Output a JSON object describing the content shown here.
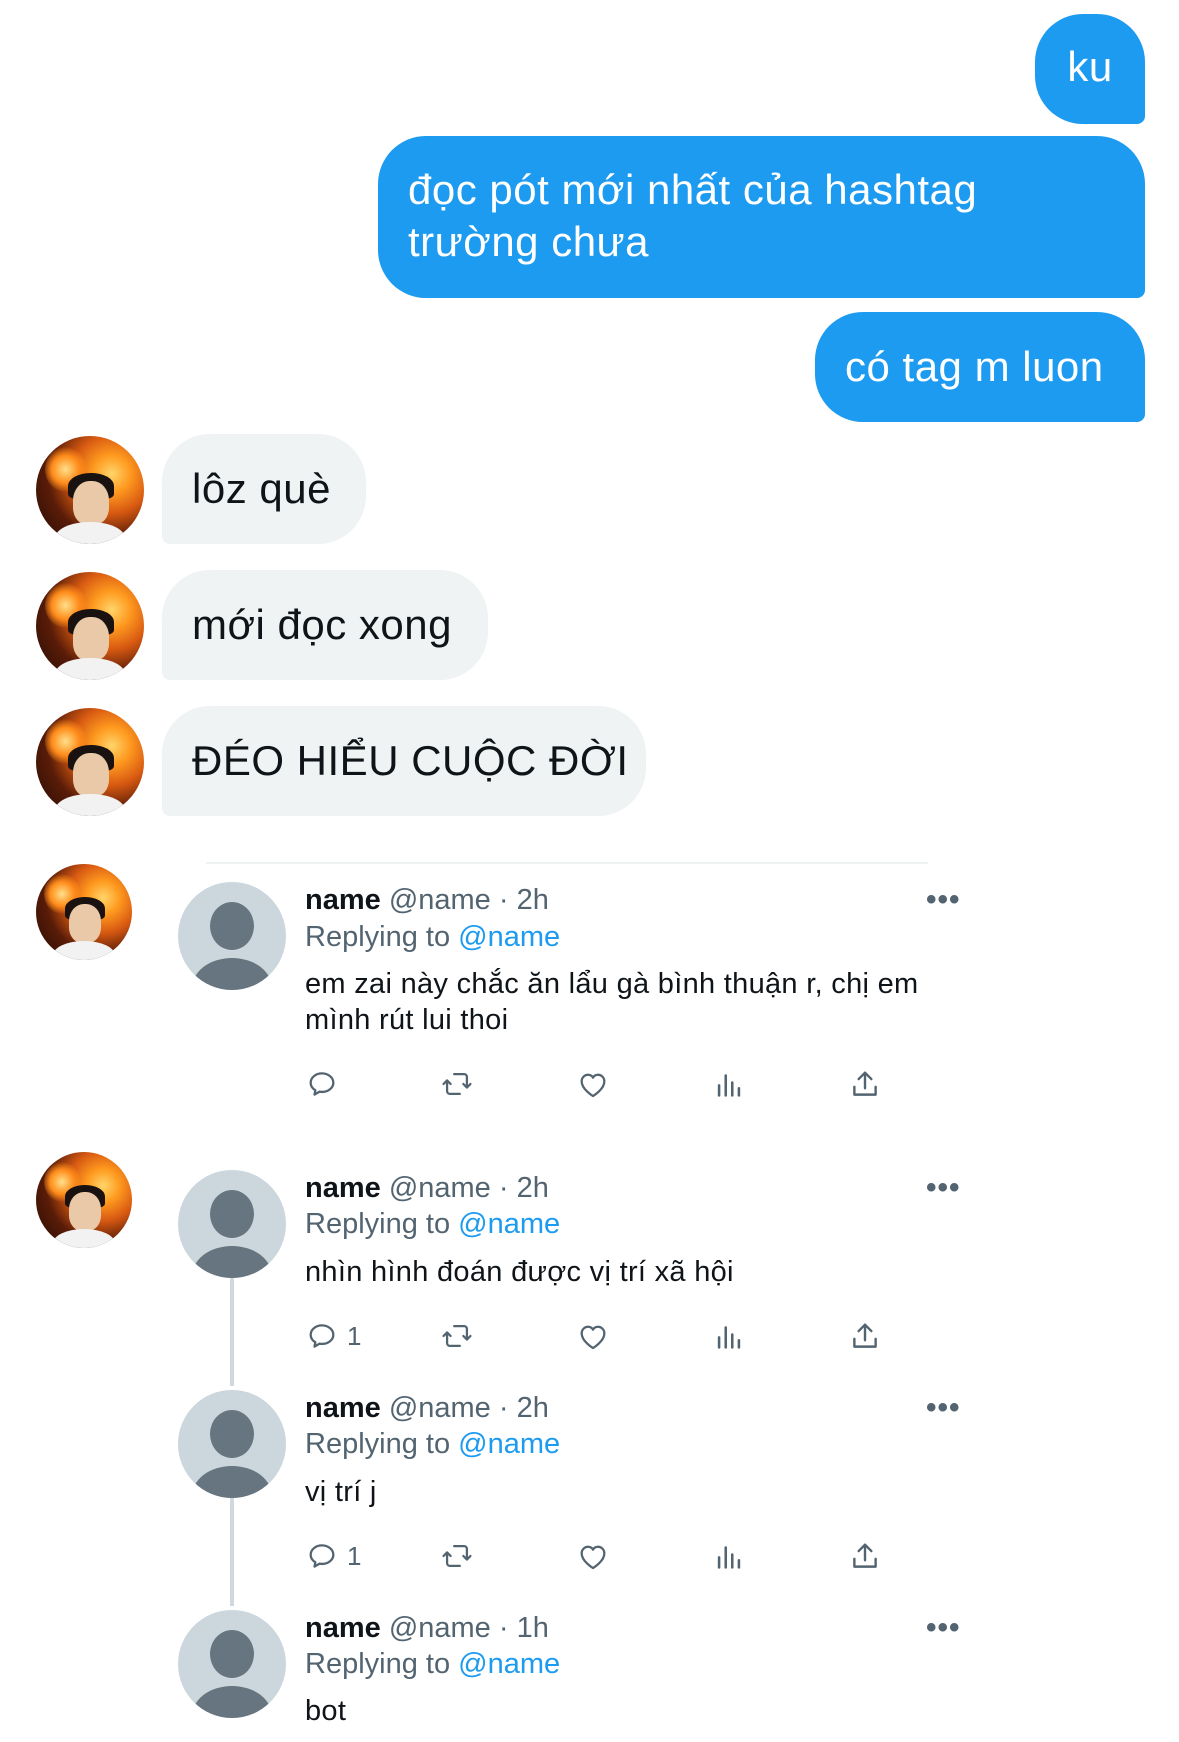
{
  "messages": {
    "sent": [
      "ku",
      "đọc pót mới nhất của hashtag trường chưa",
      "có tag m luon"
    ],
    "received": [
      "lôz què",
      "mới đọc xong",
      "ĐÉO HIỂU CUỘC ĐỜI"
    ]
  },
  "tweets": [
    {
      "name": "name",
      "handle": "@name",
      "time": "2h",
      "replying_label": "Replying to",
      "replying_handle": "@name",
      "text": "em zai này chắc ăn lẩu gà bình thuận r, chị em mình rút lui thoi",
      "reply_count": ""
    },
    {
      "name": "name",
      "handle": "@name",
      "time": "2h",
      "replying_label": "Replying to",
      "replying_handle": "@name",
      "text": "nhìn hình đoán được vị trí xã hội",
      "reply_count": "1"
    },
    {
      "name": "name",
      "handle": "@name",
      "time": "2h",
      "replying_label": "Replying to",
      "replying_handle": "@name",
      "text": "vị trí j",
      "reply_count": "1"
    },
    {
      "name": "name",
      "handle": "@name",
      "time": "1h",
      "replying_label": "Replying to",
      "replying_handle": "@name",
      "text": "bot",
      "reply_count": ""
    }
  ],
  "separator": "·",
  "more_label": "•••",
  "icons": [
    "reply-icon",
    "retweet-icon",
    "like-icon",
    "analytics-icon",
    "share-icon",
    "more-icon"
  ],
  "colors": {
    "accent": "#1d9bf0",
    "received_bubble": "#eff3f4",
    "muted": "#536471"
  }
}
